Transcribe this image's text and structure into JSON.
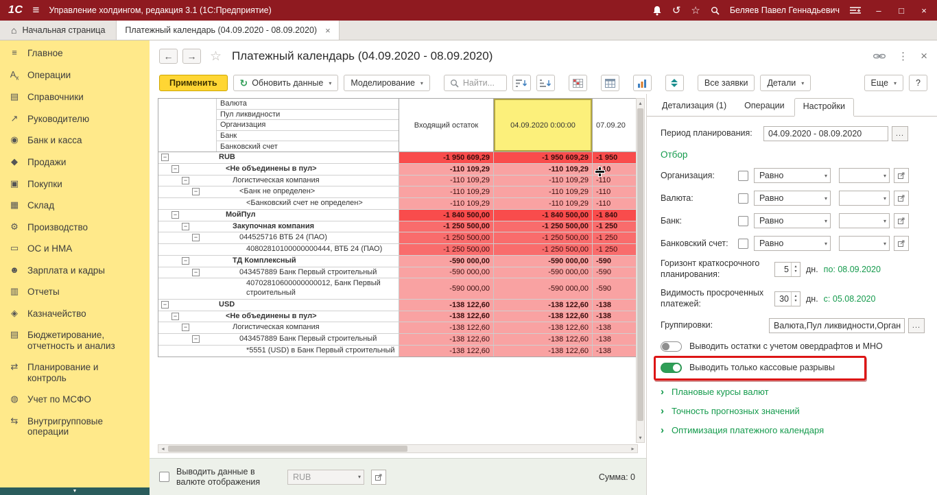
{
  "topbar": {
    "logo": "1С",
    "title": "Управление холдингом, редакция 3.1  (1С:Предприятие)",
    "user": "Беляев Павел Геннадьевич"
  },
  "tabbar": {
    "home": "Начальная страница",
    "active_tab": "Платежный календарь (04.09.2020 - 08.09.2020)"
  },
  "sidebar": {
    "items": [
      {
        "label": "Главное",
        "icon": "menu-icon"
      },
      {
        "label": "Операции",
        "icon": "operations-icon"
      },
      {
        "label": "Справочники",
        "icon": "catalogs-icon"
      },
      {
        "label": "Руководителю",
        "icon": "manager-chart-icon"
      },
      {
        "label": "Банк и касса",
        "icon": "bank-icon"
      },
      {
        "label": "Продажи",
        "icon": "sales-icon"
      },
      {
        "label": "Покупки",
        "icon": "purchases-icon"
      },
      {
        "label": "Склад",
        "icon": "warehouse-icon"
      },
      {
        "label": "Производство",
        "icon": "production-icon"
      },
      {
        "label": "ОС и НМА",
        "icon": "fixed-assets-icon"
      },
      {
        "label": "Зарплата и кадры",
        "icon": "staff-icon"
      },
      {
        "label": "Отчеты",
        "icon": "reports-icon"
      },
      {
        "label": "Казначейство",
        "icon": "treasury-icon"
      },
      {
        "label": "Бюджетирование, отчетность и анализ",
        "icon": "budgeting-icon"
      },
      {
        "label": "Планирование и контроль",
        "icon": "planning-icon"
      },
      {
        "label": "Учет по МСФО",
        "icon": "ifrs-icon"
      },
      {
        "label": "Внутригрупповые операции",
        "icon": "intragroup-icon"
      }
    ]
  },
  "page": {
    "title": "Платежный календарь (04.09.2020 - 08.09.2020)"
  },
  "toolbar": {
    "apply": "Применить",
    "refresh": "Обновить данные",
    "modeling": "Моделирование",
    "find_placeholder": "Найти...",
    "all_requests": "Все заявки",
    "details": "Детали",
    "more": "Еще",
    "help": "?"
  },
  "table": {
    "header_levels": [
      "Валюта",
      "Пул ликвидности",
      "Организация",
      "Банк",
      "Банковский счет"
    ],
    "columns": [
      "Входящий остаток",
      "04.09.2020 0:00:00",
      "07.09.20"
    ],
    "rows": [
      {
        "name": "RUB",
        "level": 0,
        "expand": true,
        "bold": true,
        "tone": "strong",
        "values": [
          "-1 950 609,29",
          "-1 950 609,29",
          "-1 950"
        ]
      },
      {
        "name": "<Не объединены в пул>",
        "level": 1,
        "expand": true,
        "bold": true,
        "tone": "pink",
        "values": [
          "-110 109,29",
          "-110 109,29",
          "-110"
        ]
      },
      {
        "name": "Логистическая компания",
        "level": 2,
        "expand": true,
        "bold": false,
        "tone": "pink",
        "values": [
          "-110 109,29",
          "-110 109,29",
          "-110"
        ]
      },
      {
        "name": "<Банк не определен>",
        "level": 3,
        "expand": true,
        "bold": false,
        "tone": "pink",
        "values": [
          "-110 109,29",
          "-110 109,29",
          "-110"
        ]
      },
      {
        "name": "<Банковский счет не определен>",
        "level": 4,
        "expand": false,
        "bold": false,
        "tone": "pink",
        "values": [
          "-110 109,29",
          "-110 109,29",
          "-110"
        ]
      },
      {
        "name": "МойПул",
        "level": 1,
        "expand": true,
        "bold": true,
        "tone": "strong",
        "values": [
          "-1 840 500,00",
          "-1 840 500,00",
          "-1 840"
        ]
      },
      {
        "name": "Закупочная компания",
        "level": 2,
        "expand": true,
        "bold": true,
        "tone": "medium",
        "values": [
          "-1 250 500,00",
          "-1 250 500,00",
          "-1 250"
        ]
      },
      {
        "name": "044525716 ВТБ 24 (ПАО)",
        "level": 3,
        "expand": true,
        "bold": false,
        "tone": "medium",
        "values": [
          "-1 250 500,00",
          "-1 250 500,00",
          "-1 250"
        ]
      },
      {
        "name": "40802810100000000444, ВТБ 24 (ПАО)",
        "level": 4,
        "expand": false,
        "bold": false,
        "tone": "medium",
        "values": [
          "-1 250 500,00",
          "-1 250 500,00",
          "-1 250"
        ]
      },
      {
        "name": "ТД Комплексный",
        "level": 2,
        "expand": true,
        "bold": true,
        "tone": "pink",
        "values": [
          "-590 000,00",
          "-590 000,00",
          "-590"
        ]
      },
      {
        "name": "043457889 Банк Первый строительный",
        "level": 3,
        "expand": true,
        "bold": false,
        "tone": "pink",
        "values": [
          "-590 000,00",
          "-590 000,00",
          "-590"
        ]
      },
      {
        "name": "40702810600000000012, Банк Первый строительный",
        "level": 4,
        "expand": false,
        "bold": false,
        "tone": "pink",
        "values": [
          "-590 000,00",
          "-590 000,00",
          "-590"
        ]
      },
      {
        "name": "USD",
        "level": 0,
        "expand": true,
        "bold": true,
        "tone": "pink",
        "values": [
          "-138 122,60",
          "-138 122,60",
          "-138"
        ]
      },
      {
        "name": "<Не объединены в пул>",
        "level": 1,
        "expand": true,
        "bold": true,
        "tone": "pink",
        "values": [
          "-138 122,60",
          "-138 122,60",
          "-138"
        ]
      },
      {
        "name": "Логистическая компания",
        "level": 2,
        "expand": true,
        "bold": false,
        "tone": "pink",
        "values": [
          "-138 122,60",
          "-138 122,60",
          "-138"
        ]
      },
      {
        "name": "043457889 Банк Первый строительный",
        "level": 3,
        "expand": true,
        "bold": false,
        "tone": "pink",
        "values": [
          "-138 122,60",
          "-138 122,60",
          "-138"
        ]
      },
      {
        "name": "*5551 (USD) в Банк Первый строительный",
        "level": 4,
        "expand": false,
        "bold": false,
        "tone": "pink",
        "values": [
          "-138 122,60",
          "-138 122,60",
          "-138"
        ]
      }
    ]
  },
  "bottom_panel": {
    "checkbox_label": "Выводить данные в валюте отображения",
    "currency": "RUB",
    "sum": "Сумма: 0"
  },
  "settings": {
    "tabs": [
      "Детализация (1)",
      "Операции",
      "Настройки"
    ],
    "active_tab": "Настройки",
    "period_label": "Период планирования:",
    "period_value": "04.09.2020 - 08.09.2020",
    "section_filter": "Отбор",
    "filters": [
      {
        "label": "Организация:",
        "op": "Равно"
      },
      {
        "label": "Валюта:",
        "op": "Равно"
      },
      {
        "label": "Банк:",
        "op": "Равно"
      },
      {
        "label": "Банковский счет:",
        "op": "Равно"
      }
    ],
    "horizon": {
      "label": "Горизонт краткосрочного планирования:",
      "value": "5",
      "unit": "дн.",
      "link": "по: 08.09.2020"
    },
    "overdue": {
      "label": "Видимость просроченных платежей:",
      "value": "30",
      "unit": "дн.",
      "link": "с: 05.08.2020"
    },
    "grouping": {
      "label": "Группировки:",
      "value": "Валюта,Пул ликвидности,Орган"
    },
    "toggle_overdraft": "Выводить остатки с учетом овердрафтов и МНО",
    "toggle_cash_gaps": "Выводить только кассовые разрывы",
    "sections": [
      "Плановые курсы валют",
      "Точность прогнозных значений",
      "Оптимизация платежного календаря"
    ]
  },
  "colors": {
    "topbar_red": "#8f1a20",
    "sidebar_yellow": "#ffe98a",
    "apply_yellow": "#ffd634",
    "accent_green": "#149a4c",
    "highlight_red": "#dd1515",
    "cell_strong_red": "#f94c4c",
    "cell_medium_red": "#f96c6c",
    "cell_pink": "#f9a2a2",
    "column_highlight": "#fcf07b"
  }
}
